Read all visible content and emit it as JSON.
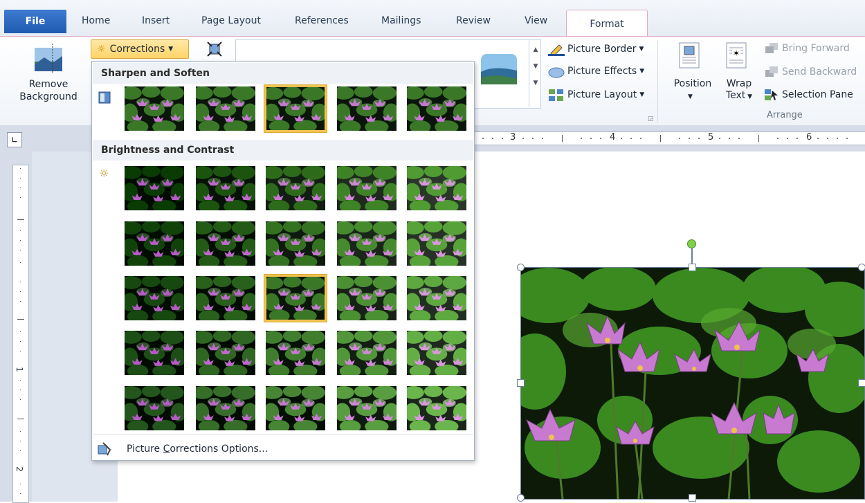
{
  "tabs": {
    "file": "File",
    "items": [
      "Home",
      "Insert",
      "Page Layout",
      "References",
      "Mailings",
      "Review",
      "View"
    ],
    "active": "Format"
  },
  "ribbon": {
    "remove_background": [
      "Remove",
      "Background"
    ],
    "corrections_label": "Corrections",
    "picture_border": "Picture Border",
    "picture_effects": "Picture Effects",
    "picture_layout": "Picture Layout",
    "position": "Position",
    "wrap_text": [
      "Wrap",
      "Text"
    ],
    "bring_forward": "Bring Forward",
    "send_backward": "Send Backward",
    "selection_pane": "Selection Pane",
    "arrange_group": "Arrange"
  },
  "ruler": {
    "h_numbers": [
      "3",
      "4",
      "5",
      "6"
    ],
    "v_numbers": [
      "1",
      "2"
    ]
  },
  "dropdown": {
    "sharpen_header": "Sharpen and Soften",
    "brightness_header": "Brightness and Contrast",
    "options_prefix": "Picture ",
    "options_accel": "C",
    "options_suffix": "orrections Options..."
  },
  "colors": {
    "accent_selected": "#f2c34e",
    "file_tab": "#2a63b8",
    "active_tab_border": "#e0a9c7"
  }
}
